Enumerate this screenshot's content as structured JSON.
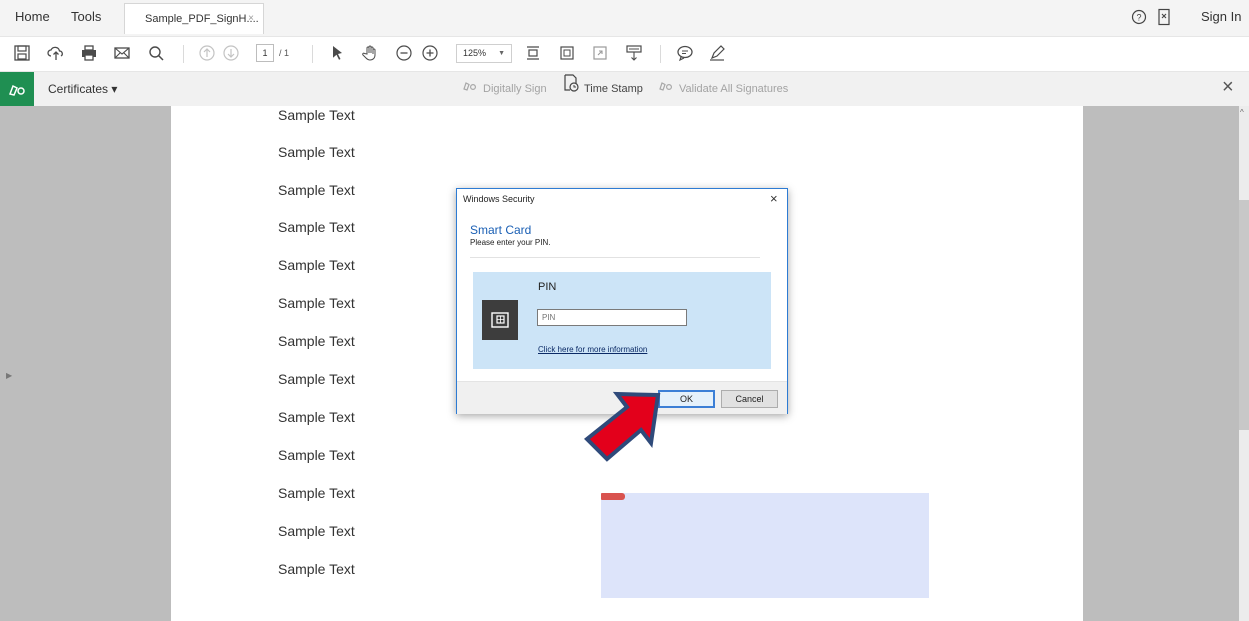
{
  "nav": {
    "home": "Home",
    "tools": "Tools"
  },
  "tab": {
    "label": "Sample_PDF_SignH....",
    "close": "×"
  },
  "header": {
    "sign_in": "Sign In"
  },
  "toolbar": {
    "page_current": "1",
    "page_total": "/ 1",
    "zoom": "125%"
  },
  "cert_bar": {
    "certificates": "Certificates ▾",
    "digitally_sign": "Digitally Sign",
    "time_stamp": "Time Stamp",
    "validate": "Validate All Signatures",
    "close": "×"
  },
  "document": {
    "lines": [
      "Sample Text",
      "Sample Text",
      "Sample Text",
      "Sample Text",
      "Sample Text",
      "Sample Text",
      "Sample Text",
      "Sample Text",
      "Sample Text",
      "Sample Text",
      "Sample Text",
      "Sample Text",
      "Sample Text"
    ]
  },
  "dialog": {
    "title": "Windows Security",
    "close": "×",
    "heading": "Smart Card",
    "subheading": "Please enter your PIN.",
    "pin_label": "PIN",
    "pin_placeholder": "PIN",
    "pin_value": "",
    "info_link": "Click here for more information",
    "ok": "OK",
    "cancel": "Cancel"
  },
  "colors": {
    "accent": "#2d7bd3",
    "cert_green": "#1f8f52",
    "arrow_fill": "#e3001b",
    "arrow_outline": "#2f4a7a",
    "sig_field": "#dde4fa"
  }
}
